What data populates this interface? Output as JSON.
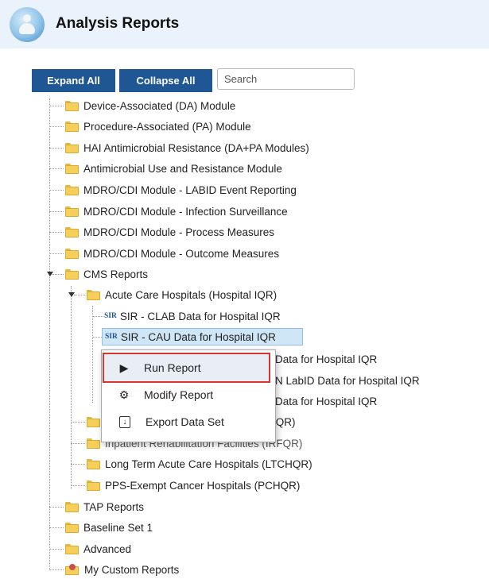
{
  "header": {
    "title": "Analysis Reports"
  },
  "toolbar": {
    "expand_label": "Expand All",
    "collapse_label": "Collapse All",
    "search_placeholder": "Search"
  },
  "tree": {
    "top": [
      "Device-Associated (DA) Module",
      "Procedure-Associated (PA) Module",
      "HAI Antimicrobial Resistance (DA+PA Modules)",
      "Antimicrobial Use and Resistance Module",
      "MDRO/CDI Module - LABID Event Reporting",
      "MDRO/CDI Module - Infection Surveillance",
      "MDRO/CDI Module - Process Measures",
      "MDRO/CDI Module - Outcome Measures"
    ],
    "cms": "CMS Reports",
    "acute": "Acute Care Hospitals (Hospital IQR)",
    "sir_badge": "SIR",
    "sir_items": [
      "SIR - CLAB Data for Hospital IQR",
      "SIR - CAU Data for Hospital IQR",
      "Data for Hospital IQR",
      "N LabID Data for Hospital IQR",
      "Data for Hospital IQR"
    ],
    "cms_sub": [
      "ital IQR)",
      "Inpatient Rehabilitation Facilities (IRFQR)",
      "Long Term Acute Care Hospitals (LTCHQR)",
      "PPS-Exempt Cancer Hospitals (PCHQR)"
    ],
    "bottom": [
      "TAP Reports",
      "Baseline Set 1",
      "Advanced"
    ],
    "custom": "My Custom Reports"
  },
  "context_menu": {
    "run": "Run Report",
    "modify": "Modify Report",
    "export": "Export Data Set"
  }
}
